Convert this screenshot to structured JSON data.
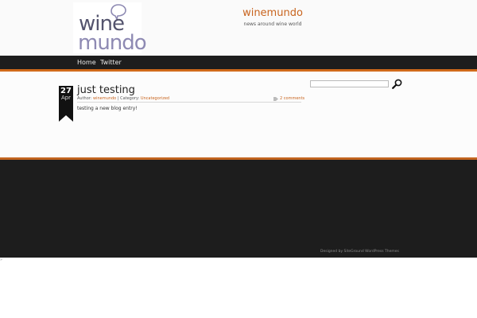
{
  "site": {
    "logo_wine": "wine",
    "logo_mundo": "mundo",
    "title": "winemundo",
    "tagline": "news around wine world"
  },
  "nav": {
    "items": [
      {
        "label": "Home"
      },
      {
        "label": "Twitter"
      }
    ]
  },
  "post": {
    "day": "27",
    "month": "Apr",
    "title": "just testing",
    "author_label": "Author:",
    "author": "winemundo",
    "separator": "|",
    "category_label": "Category:",
    "category": "Uncategorized",
    "comments": "2 comments",
    "body": "testing a new blog entry!"
  },
  "search": {
    "value": "",
    "placeholder": ""
  },
  "footer": {
    "credit": "Designed by SiteGround WordPress Themes"
  },
  "bottom_mark": "»",
  "colors": {
    "accent": "#c8641e",
    "nav_bg": "#1d1d1d",
    "orange_line": "#d06a1b"
  }
}
